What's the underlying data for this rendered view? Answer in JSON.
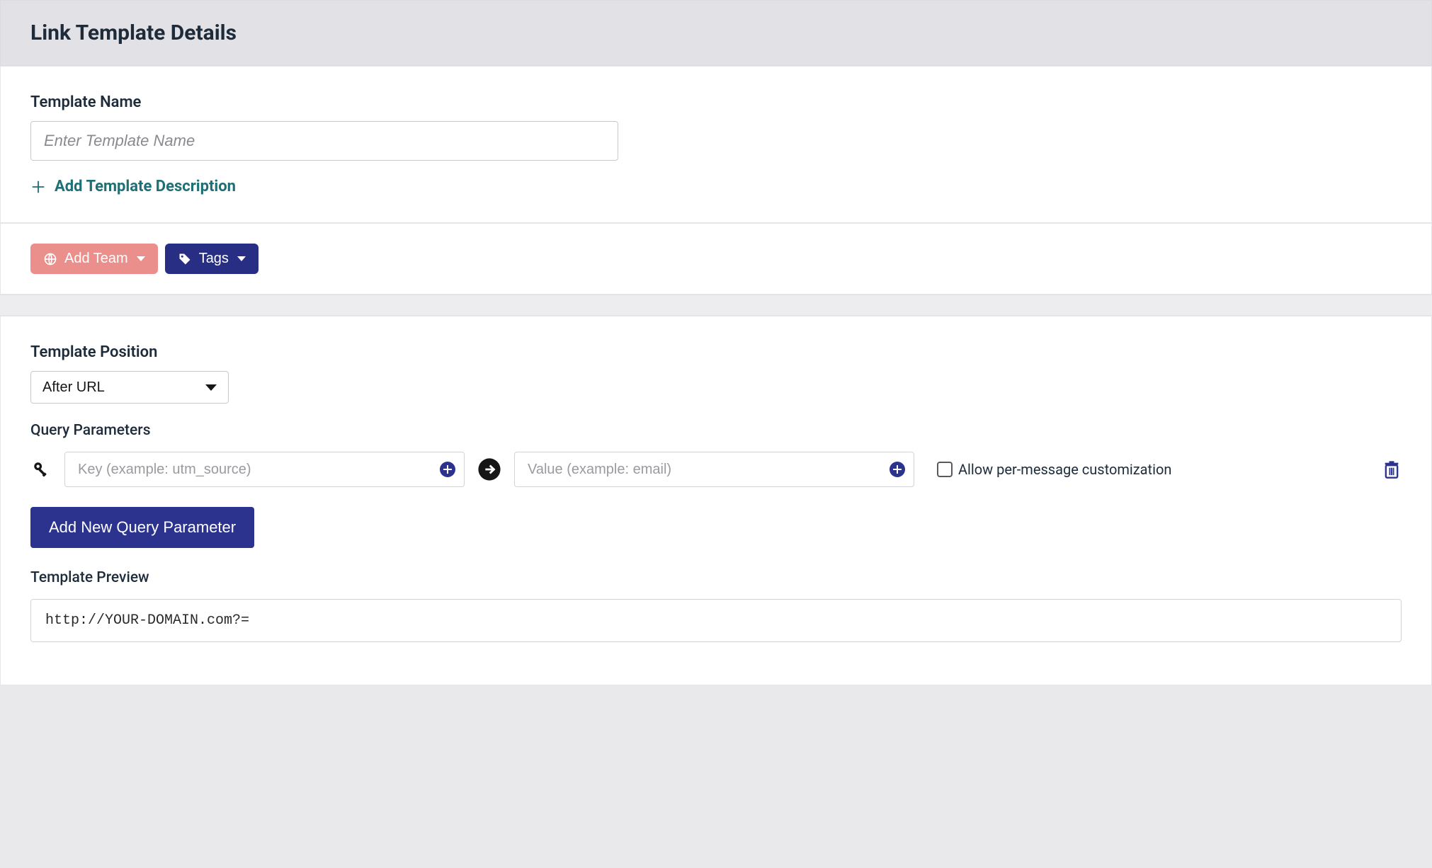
{
  "header": {
    "title": "Link Template Details"
  },
  "section1": {
    "name_label": "Template Name",
    "name_placeholder": "Enter Template Name",
    "add_description_label": "Add Template Description"
  },
  "section2": {
    "add_team_label": "Add Team",
    "tags_label": "Tags"
  },
  "section3": {
    "position_label": "Template Position",
    "position_value": "After URL",
    "qp_label": "Query Parameters",
    "key_placeholder": "Key (example: utm_source)",
    "value_placeholder": "Value (example: email)",
    "allow_custom_label": "Allow per-message customization",
    "add_param_btn": "Add New Query Parameter",
    "preview_label": "Template Preview",
    "preview_value": "http://YOUR-DOMAIN.com?="
  }
}
